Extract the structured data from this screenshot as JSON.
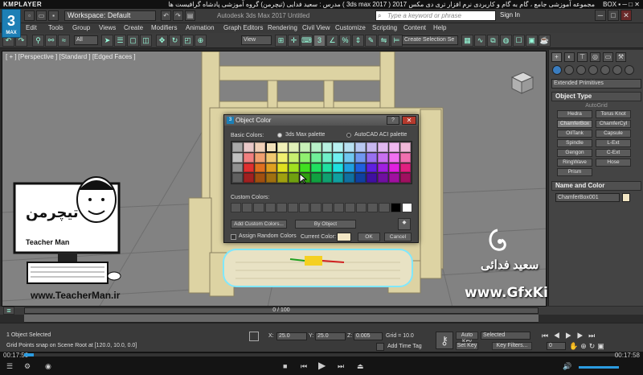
{
  "player": {
    "logo": "KMPLAYER",
    "title": "مجموعه آموزشی جامع ، گام به گام و کاربردی نرم افزار تری دی مکس 2017 ( 3ds max 2017 )  مدرس : سعید فدایی (تیچرمن) گروه آموزشی پادشاه گرافیست ها",
    "controls": "BOX ▪ ─ □ ✕"
  },
  "app": {
    "logo": "3",
    "logo_sub": "MAX",
    "workspace": "Workspace: Default",
    "title": "Autodesk 3ds Max 2017    Untitled",
    "search_placeholder": "Type a keyword or phrase",
    "signin": "Sign In"
  },
  "menu": [
    "Edit",
    "Tools",
    "Group",
    "Views",
    "Create",
    "Modifiers",
    "Animation",
    "Graph Editors",
    "Rendering",
    "Civil View",
    "Customize",
    "Scripting",
    "Content",
    "Help"
  ],
  "toolbar": {
    "filter": "All",
    "view": "View",
    "selection_set": "Create Selection Se"
  },
  "viewport": {
    "label": "[ + ] [Perspective ] [Standard ] [Edged Faces ]"
  },
  "command_panel": {
    "category": "Extended Primitives",
    "object_type": "Object Type",
    "autogrid": "AutoGrid",
    "buttons": [
      "Hedra",
      "Torus Knot",
      "ChamferBox",
      "ChamferCyl",
      "OilTank",
      "Capsule",
      "Spindle",
      "L-Ext",
      "Gengon",
      "C-Ext",
      "RingWave",
      "Hose",
      "Prism"
    ],
    "name_and_color": "Name and Color",
    "object_name": "ChamferBox001"
  },
  "dialog": {
    "title": "Object Color",
    "help": "?",
    "close": "✕",
    "basic_colors": "Basic Colors:",
    "palette_max": "3ds Max palette",
    "palette_acad": "AutoCAD ACI palette",
    "custom_colors": "Custom Colors:",
    "add_custom": "Add Custom Colors...",
    "by_object": "By Object",
    "assign_random": "Assign Random Colors",
    "current_color": "Current Color:",
    "ok": "OK",
    "cancel": "Cancel",
    "current_swatch": "#f2e6c4",
    "palette": [
      [
        "#a8a8a8",
        "#e8c8c8",
        "#f0d0b8",
        "#f0e0b8",
        "#f0f0b8",
        "#e0f0b8",
        "#c8f0b8",
        "#b8f0c8",
        "#b8f0e0",
        "#b8f0f0",
        "#b8e0f0",
        "#b8c8f0",
        "#c8b8f0",
        "#e0b8f0",
        "#f0b8f0",
        "#f0b8d8"
      ],
      [
        "#c0c0c0",
        "#f08080",
        "#f0a070",
        "#f0c870",
        "#f0f070",
        "#c8f070",
        "#90f070",
        "#70f098",
        "#70f0c8",
        "#70f0f0",
        "#70c8f0",
        "#7098f0",
        "#9870f0",
        "#c870f0",
        "#f070f0",
        "#f070b0"
      ],
      [
        "#909090",
        "#e03030",
        "#e07020",
        "#e0a020",
        "#e0e020",
        "#a0e020",
        "#40e020",
        "#20e060",
        "#20e0a0",
        "#20e0e0",
        "#20a0e0",
        "#2060e0",
        "#6020e0",
        "#a020e0",
        "#e020e0",
        "#e02080"
      ],
      [
        "#606060",
        "#a02020",
        "#a05010",
        "#a07010",
        "#a0a010",
        "#70a010",
        "#30a010",
        "#10a040",
        "#10a070",
        "#10a0a0",
        "#1070a0",
        "#1040a0",
        "#4010a0",
        "#7010a0",
        "#a010a0",
        "#a01060"
      ]
    ],
    "selected_cell": "0.3"
  },
  "watermark": {
    "gfx": "www.GfxKing.ir",
    "name": "سعید فدائی",
    "url": "www.TeacherMan.ir",
    "teacher": "Teacher Man",
    "teacher_fa": "تیچرمن"
  },
  "timeline": {
    "frame": "0 / 100"
  },
  "status": {
    "selected": "1 Object Selected",
    "prompt": "Grid Points snap on Scene Root at [120.0, 10.0, 0.0]",
    "x_label": "X:",
    "x": "25.0",
    "y_label": "Y:",
    "y": "25.0",
    "z_label": "Z:",
    "z": "0.005",
    "grid": "Grid = 10.0",
    "add_time_tag": "Add Time Tag",
    "auto_key": "Auto Key",
    "set_key": "Set Key",
    "selected_dd": "Selected",
    "key_filters": "Key Filters..."
  },
  "playback": {
    "time_left": "00:17:50",
    "time_right": "00:17:58"
  },
  "colors": {
    "accent": "#1d7fb5",
    "object_color": "#f2e6c4"
  }
}
